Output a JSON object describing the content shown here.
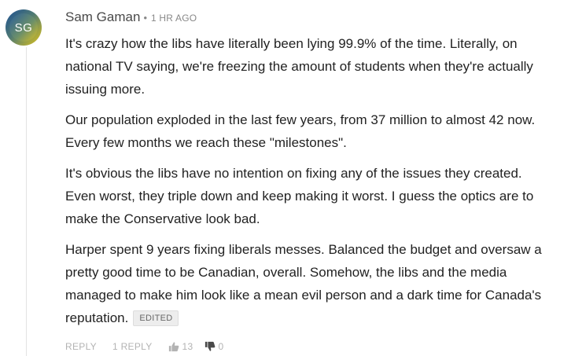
{
  "comment": {
    "avatar_initials": "SG",
    "author": "Sam Gaman",
    "separator": "•",
    "timestamp": "1 HR AGO",
    "paragraphs": [
      "It's crazy how the libs have literally been lying 99.9% of the time. Literally, on national TV saying, we're freezing the amount of students when they're actually issuing more.",
      "Our population exploded in the last few years, from 37 million to almost 42 now. Every few months we reach these \"milestones\".",
      "It's obvious the libs have no intention on fixing any of the issues they created. Even worst, they triple down and keep making it worst. I guess the optics are to make the Conservative look bad.",
      "Harper spent 9 years fixing liberals messes. Balanced the budget and oversaw a pretty good time to be Canadian, overall. Somehow, the libs and the media managed to make him look like a mean evil person and a dark time for Canada's reputation."
    ],
    "edited_badge": "EDITED"
  },
  "actions": {
    "reply_label": "REPLY",
    "replies_label": "1 REPLY",
    "upvote_icon": "thumbs-up-icon",
    "upvotes": "13",
    "downvote_icon": "thumbs-down-icon",
    "downvotes": "0"
  },
  "colors": {
    "text": "#222222",
    "meta": "#888888",
    "actions": "#b3b3b3",
    "badge_bg": "#ededed"
  }
}
